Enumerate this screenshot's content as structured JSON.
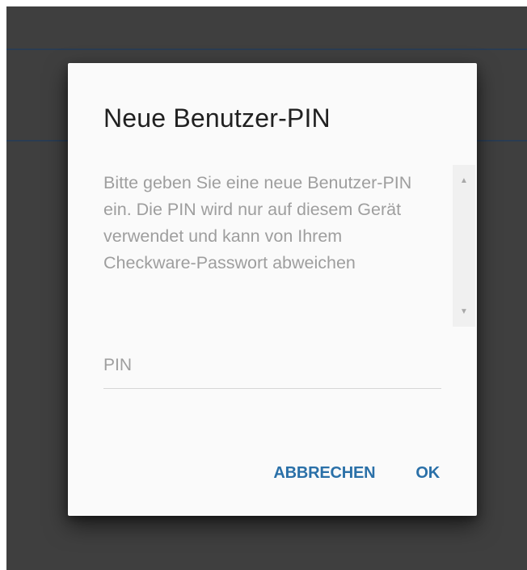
{
  "dialog": {
    "title": "Neue Benutzer-PIN",
    "message": "Bitte geben Sie eine neue Benutzer-PIN ein. Die PIN wird nur auf diesem Gerät verwendet und kann von Ihrem Checkware-Passwort abweichen",
    "pin_field": {
      "placeholder": "PIN",
      "value": ""
    },
    "buttons": {
      "cancel_label": "ABBRECHEN",
      "ok_label": "OK"
    }
  },
  "icons": {
    "scroll_up": "triangle-up-icon",
    "scroll_down": "triangle-down-icon"
  },
  "colors": {
    "background": "#3f3f3f",
    "dialog": "#fafafa",
    "title": "#212121",
    "message": "#9e9e9e",
    "accent": "#2a70a8"
  }
}
